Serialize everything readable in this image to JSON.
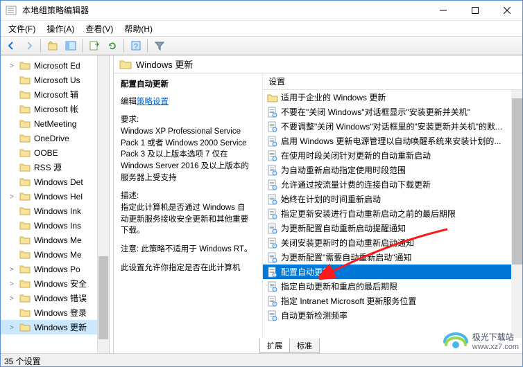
{
  "window": {
    "title": "本地组策略编辑器"
  },
  "menu": {
    "file": "文件(F)",
    "action": "操作(A)",
    "view": "查看(V)",
    "help": "帮助(H)"
  },
  "tree": {
    "items": [
      {
        "label": "Microsoft Ed",
        "exp": ">"
      },
      {
        "label": "Microsoft Us",
        "exp": ""
      },
      {
        "label": "Microsoft 辅",
        "exp": ""
      },
      {
        "label": "Microsoft 帐",
        "exp": ""
      },
      {
        "label": "NetMeeting",
        "exp": ""
      },
      {
        "label": "OneDrive",
        "exp": ""
      },
      {
        "label": "OOBE",
        "exp": ""
      },
      {
        "label": "RSS 源",
        "exp": ""
      },
      {
        "label": "Windows Det",
        "exp": ""
      },
      {
        "label": "Windows Hel",
        "exp": ">"
      },
      {
        "label": "Windows Ink",
        "exp": ""
      },
      {
        "label": "Windows Ins",
        "exp": ""
      },
      {
        "label": "Windows Me",
        "exp": ""
      },
      {
        "label": "Windows Me",
        "exp": ""
      },
      {
        "label": "Windows Po",
        "exp": ">"
      },
      {
        "label": "Windows 安全",
        "exp": ">"
      },
      {
        "label": "Windows 错误",
        "exp": ">"
      },
      {
        "label": "Windows 登录",
        "exp": ""
      },
      {
        "label": "Windows 更新",
        "exp": ">",
        "selected": true
      }
    ]
  },
  "content": {
    "header": "Windows 更新",
    "desc": {
      "title": "配置自动更新",
      "edit_prefix": "编辑",
      "edit_link": "策略设置",
      "req_label": "要求:",
      "req_text": "Windows XP Professional Service Pack 1 或者 Windows 2000 Service Pack 3 及以上版本选项 7 仅在 Windows Server 2016 及以上版本的服务器上受支持",
      "desc_label": "描述:",
      "desc_text": "指定此计算机是否通过 Windows 自动更新服务接收安全更新和其他重要下载。",
      "note_text": "注意: 此策略不适用于 Windows RT。",
      "tail_text": "此设置允许你指定是否在此计算机"
    },
    "list": {
      "header": "设置",
      "folder_item": "适用于企业的 Windows 更新",
      "items": [
        "不要在\"关闭 Windows\"对话框显示\"安装更新并关机\"",
        "不要调整\"关闭 Windows\"对话框里的\"安装更新并关机\"的默...",
        "启用 Windows 更新电源管理以自动唤醒系统来安装计划的...",
        "在使用时段关闭针对更新的自动重新启动",
        "为自动重新启动指定使用时段范围",
        "允许通过按流量计费的连接自动下载更新",
        "始终在计划的时间重新启动",
        "指定更新安装进行自动重新启动之前的最后期限",
        "为更新配置自动重新启动提醒通知",
        "关闭安装更新时的自动重新启动通知",
        "为更新配置\"需要自动重新启动\"通知",
        "配置自动更新",
        "指定自动更新和重启的最后期限",
        "指定 Intranet Microsoft 更新服务位置",
        "自动更新检测频率"
      ],
      "selected_index": 11
    },
    "tabs": {
      "extended": "扩展",
      "standard": "标准"
    }
  },
  "statusbar": "35 个设置",
  "watermark": {
    "name": "极光下载站",
    "url": "www.xz7.com"
  }
}
